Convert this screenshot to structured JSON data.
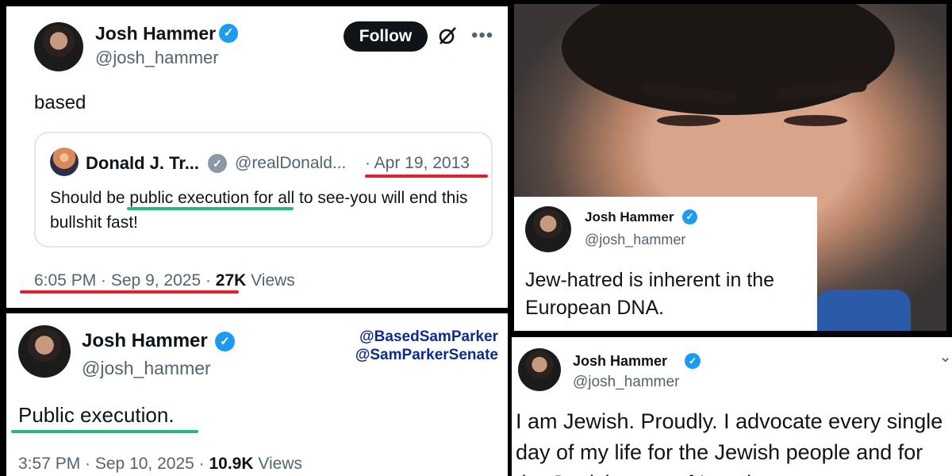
{
  "tweet_main": {
    "name": "Josh Hammer",
    "handle": "@josh_hammer",
    "follow_label": "Follow",
    "text": "based",
    "quote": {
      "name": "Donald J. Tr...",
      "handle": "@realDonald...",
      "date": "· Apr 19, 2013",
      "text_before": "Should be ",
      "text_highlight": "public execution",
      "text_after": " for all to see-you will end this bullshit fast!"
    },
    "meta": {
      "time": "6:05 PM · Sep 9, 2025 · ",
      "views_count": "27K",
      "views_label": " Views"
    }
  },
  "tweet_photo": {
    "name": "Josh Hammer",
    "handle": "@josh_hammer",
    "text": "Jew-hatred is inherent in the European DNA."
  },
  "tweet_execution": {
    "name": "Josh Hammer",
    "handle": "@josh_hammer",
    "mentions": [
      "@BasedSamParker",
      "@SamParkerSenate"
    ],
    "text": "Public execution.",
    "meta": {
      "time": "3:57 PM · Sep 10, 2025 · ",
      "views_count": "10.9K",
      "views_label": " Views"
    }
  },
  "tweet_jewish": {
    "name": "Josh Hammer",
    "handle": "@josh_hammer",
    "text": "I am Jewish. Proudly. I advocate every single day of my life for the Jewish people and for the Jewish state of Israel."
  },
  "colors": {
    "verified": "#1d9bf0",
    "highlight_red": "#e0202a",
    "highlight_green": "#27b978",
    "mention_blue": "#0b2c8c"
  },
  "icons": {
    "verified": "verified-badge-icon",
    "grok": "grok-icon",
    "more": "more-dots-icon"
  }
}
